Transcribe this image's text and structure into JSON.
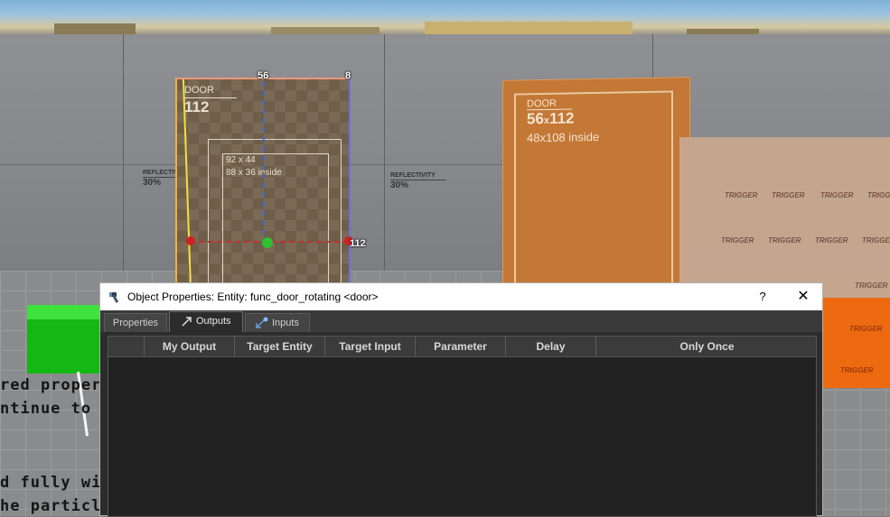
{
  "scene": {
    "reflectivity_label": "REFLECTIVITY",
    "reflectivity_value": "30%",
    "selected_door": {
      "label": "DOOR",
      "number": "112",
      "inner_size": "92 x 44",
      "inner_inside": "88 x 36 inside",
      "top_value": "56",
      "corner_value": "8",
      "right_value": "112"
    },
    "other_door": {
      "label": "DOOR",
      "size_a": "56",
      "size_x": "x",
      "size_b": "112",
      "inside": "48x108 inside"
    },
    "trigger_label": "TRIGGER",
    "ground_lines": [
      "red propert",
      "ntinue to o",
      "d fully will",
      "he particle"
    ]
  },
  "dialog": {
    "title": "Object Properties: Entity: func_door_rotating <door>",
    "help_label": "?",
    "close_label": "✕",
    "tabs": [
      {
        "label": "Properties",
        "icon": ""
      },
      {
        "label": "Outputs",
        "icon": "output-arrow-icon"
      },
      {
        "label": "Inputs",
        "icon": "input-arrow-icon"
      }
    ],
    "active_tab": "Outputs",
    "columns": [
      "",
      "My Output",
      "Target Entity",
      "Target Input",
      "Parameter",
      "Delay",
      "Only Once"
    ]
  }
}
